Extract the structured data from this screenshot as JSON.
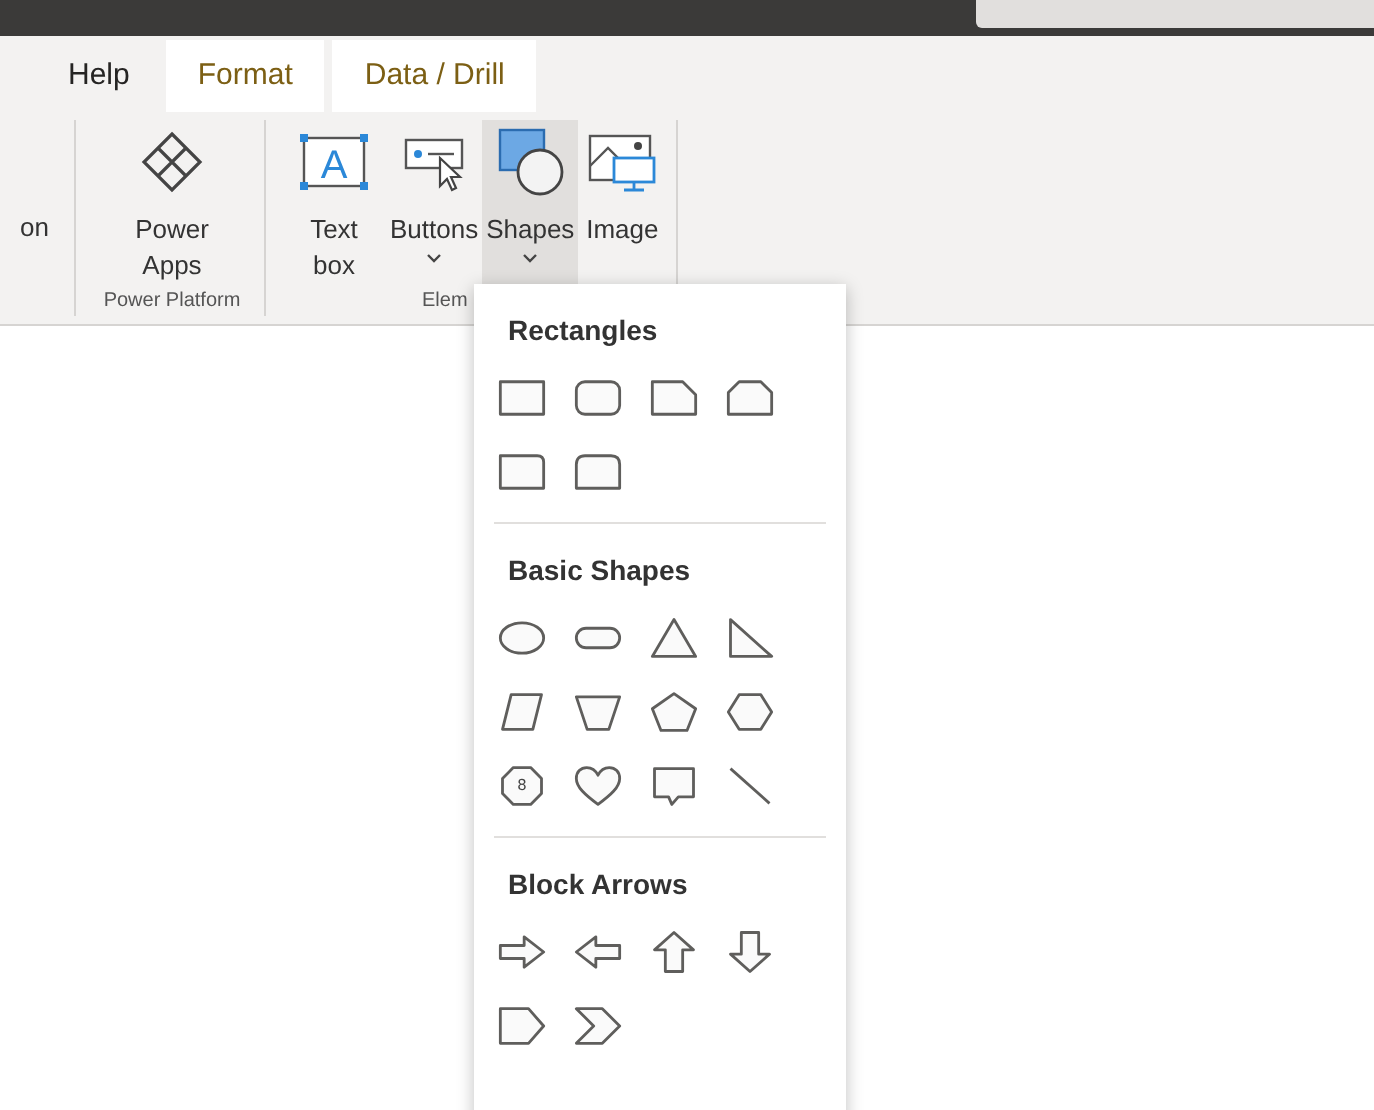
{
  "tabs": [
    {
      "label": "Help",
      "selected": false
    },
    {
      "label": "Format",
      "selected": true
    },
    {
      "label": "Data / Drill",
      "selected": true
    }
  ],
  "ribbon": {
    "partial_label": "on",
    "groups": [
      {
        "label": "Power Platform",
        "buttons": [
          {
            "kind": "powerapps",
            "label": "Power Apps",
            "menu": false,
            "selected": false
          }
        ]
      },
      {
        "label": "Elem",
        "buttons": [
          {
            "kind": "textbox",
            "glyph": "A",
            "label": "Text box",
            "menu": false,
            "selected": false
          },
          {
            "kind": "buttons",
            "label": "Buttons",
            "menu": true,
            "selected": false
          },
          {
            "kind": "shapes",
            "label": "Shapes",
            "menu": true,
            "selected": true
          },
          {
            "kind": "image",
            "label": "Image",
            "menu": false,
            "selected": false
          }
        ]
      }
    ]
  },
  "shapes_menu": {
    "sections": [
      {
        "title": "Rectangles",
        "shapes": [
          {
            "kind": "rectangle"
          },
          {
            "kind": "rounded-rectangle"
          },
          {
            "kind": "snip-corner"
          },
          {
            "kind": "snip-top"
          },
          {
            "kind": "round-corner"
          },
          {
            "kind": "round-top"
          }
        ]
      },
      {
        "title": "Basic Shapes",
        "shapes": [
          {
            "kind": "oval"
          },
          {
            "kind": "pill"
          },
          {
            "kind": "triangle"
          },
          {
            "kind": "right-triangle"
          },
          {
            "kind": "parallelogram"
          },
          {
            "kind": "trapezoid"
          },
          {
            "kind": "pentagon"
          },
          {
            "kind": "hexagon"
          },
          {
            "kind": "octagon",
            "label": "8"
          },
          {
            "kind": "heart"
          },
          {
            "kind": "callout"
          },
          {
            "kind": "line"
          }
        ]
      },
      {
        "title": "Block Arrows",
        "shapes": [
          {
            "kind": "arrow-right"
          },
          {
            "kind": "arrow-left"
          },
          {
            "kind": "arrow-up"
          },
          {
            "kind": "arrow-down"
          },
          {
            "kind": "pentagon-arrow"
          },
          {
            "kind": "chevron"
          }
        ]
      }
    ]
  }
}
